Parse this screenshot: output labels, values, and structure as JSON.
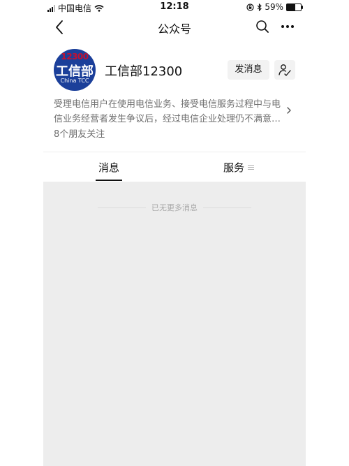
{
  "status_bar": {
    "carrier": "中国电信",
    "time": "12:18",
    "battery": "59%",
    "battery_level": 0.59
  },
  "nav": {
    "title": "公众号"
  },
  "profile": {
    "avatar": {
      "number": "12300",
      "name_cn": "工信部",
      "name_en": "China TCC"
    },
    "name": "工信部12300",
    "send_message_label": "发消息",
    "description": "受理电信用户在使用电信业务、接受电信服务过程中与电信业务经营者发生争议后，经过电信企业处理仍不满意…",
    "friends_following": "8个朋友关注"
  },
  "tabs": {
    "messages": "消息",
    "services": "服务"
  },
  "messages": {
    "empty_text": "已无更多消息"
  },
  "colors": {
    "avatar_bg": "#1b3f9a",
    "avatar_number": "#c6102e",
    "message_bg": "#ededed"
  }
}
